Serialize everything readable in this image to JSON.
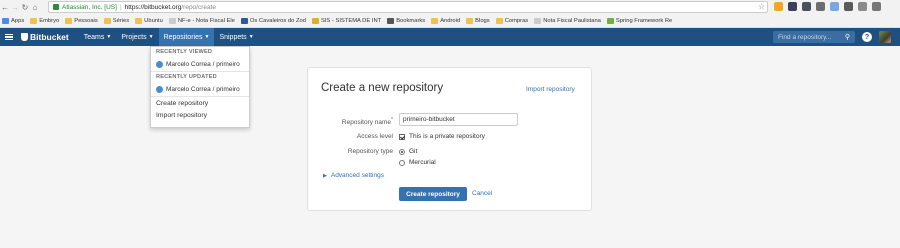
{
  "browser": {
    "security_label": "Atlassian, Inc. [US]",
    "url_host": "https://bitbucket.org",
    "url_path": "/repo/create",
    "bookmarks": [
      {
        "label": "Apps",
        "icon": "apps-grid-icon",
        "color": "#4a8af4"
      },
      {
        "label": "Embryo",
        "icon": "folder-icon",
        "color": "#f0c24b"
      },
      {
        "label": "Pessoais",
        "icon": "folder-icon",
        "color": "#f0c24b"
      },
      {
        "label": "Séries",
        "icon": "folder-icon",
        "color": "#f0c24b"
      },
      {
        "label": "Ubuntu",
        "icon": "folder-icon",
        "color": "#f0c24b"
      },
      {
        "label": "NF-e - Nota Fiscal Ele",
        "icon": "page-icon",
        "color": "#cccccc"
      },
      {
        "label": "Os Cavaleiros do Zod",
        "icon": "site-icon",
        "color": "#2c5aa0"
      },
      {
        "label": "SIS - SISTEMA DE INT",
        "icon": "site-icon",
        "color": "#e0b020"
      },
      {
        "label": "Bookmarks",
        "icon": "star-icon",
        "color": "#555555"
      },
      {
        "label": "Android",
        "icon": "folder-icon",
        "color": "#f0c24b"
      },
      {
        "label": "Blogs",
        "icon": "folder-icon",
        "color": "#f0c24b"
      },
      {
        "label": "Compras",
        "icon": "folder-icon",
        "color": "#f0c24b"
      },
      {
        "label": "Nota Fiscal Paulistana",
        "icon": "page-icon",
        "color": "#cccccc"
      },
      {
        "label": "Spring Framework Re",
        "icon": "site-icon",
        "color": "#6db33f"
      }
    ]
  },
  "header": {
    "brand": "Bitbucket",
    "nav": [
      {
        "label": "Teams",
        "active": false
      },
      {
        "label": "Projects",
        "active": false
      },
      {
        "label": "Repositories",
        "active": true
      },
      {
        "label": "Snippets",
        "active": false
      }
    ],
    "search_placeholder": "Find a repository...",
    "help": "?"
  },
  "dropdown": {
    "recent_viewed_heading": "RECENTLY VIEWED",
    "recent_viewed_item": "Marcelo Correa / primeiro",
    "recent_updated_heading": "RECENTLY UPDATED",
    "recent_updated_item": "Marcelo Correa / primeiro",
    "create_link": "Create repository",
    "import_link": "Import repository"
  },
  "form": {
    "title": "Create a new repository",
    "import_link": "Import repository",
    "name_label": "Repository name",
    "name_required": "*",
    "name_value": "primeiro-bitbucket",
    "access_label": "Access level",
    "access_option": "This is a private repository",
    "access_checked": true,
    "type_label": "Repository type",
    "type_options": [
      "Git",
      "Mercurial"
    ],
    "type_selected": "Git",
    "advanced": "Advanced settings",
    "submit": "Create repository",
    "cancel": "Cancel"
  },
  "colors": {
    "header_bg": "#205081",
    "active_nav": "#3572b0",
    "link": "#3572b0",
    "primary_button": "#3572b0"
  }
}
